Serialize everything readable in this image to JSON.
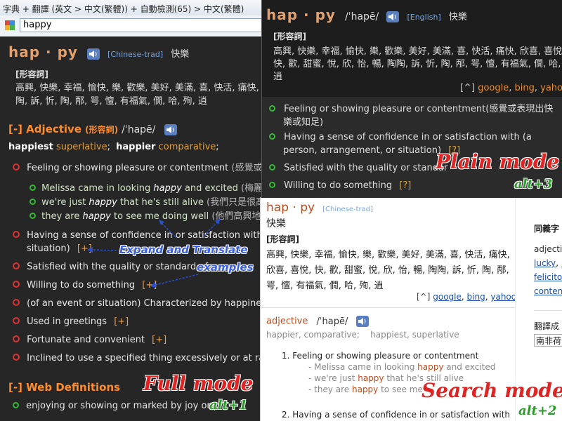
{
  "window": {
    "title": "字典 + 翻譯 (英文 > 中文(繁體)) + 自動檢測(65) > 中文(繁體)"
  },
  "search": {
    "value": "happy"
  },
  "full": {
    "headword": "hap · py",
    "lang_tag": "[Chinese-trad]",
    "zh_word": "快樂",
    "pos_zh": "[形容詞]",
    "zh_line1": "高興, 快樂, 幸福, 愉快, 樂, 歡樂, 美好, 美滿, 喜, 快活, 痛快, 欣",
    "zh_line2": "陶, 訴, 忻, 陶, 邴, 咢, 憻, 有福氣, 僩, 哈, 殉, 逍",
    "adj_head": "[-] Adjective",
    "adj_zh": "(形容詞)",
    "adj_pron": "/ˈhapē/",
    "forms": [
      {
        "w": "happiest",
        "t": "superlative"
      },
      {
        "w": "happier",
        "t": "comparative"
      }
    ],
    "senses": [
      {
        "text": "Feeling or showing pleasure or contentment",
        "zh": "(感覺或表",
        "plus": ""
      },
      {
        "text": "Having a sense of confidence in or satisfaction with (a",
        "zh": "",
        "plus": ""
      },
      {
        "text": "situation)",
        "zh": "",
        "plus": "[+]"
      },
      {
        "text": "Satisfied with the quality or standard of",
        "zh": "",
        "plus": ""
      },
      {
        "text": "Willing to do something",
        "zh": "",
        "plus": "[+]"
      },
      {
        "text": "(of an event or situation) Characterized by happiness",
        "zh": "",
        "plus": ""
      },
      {
        "text": "Used in greetings",
        "zh": "",
        "plus": "[+]"
      },
      {
        "text": "Fortunate and convenient",
        "zh": "",
        "plus": "[+]"
      },
      {
        "text": "Inclined to use a specified thing excessively or at rando",
        "zh": "",
        "plus": ""
      }
    ],
    "examples": [
      {
        "a": "Melissa came in looking ",
        "b": "happy",
        "c": " and excited",
        "zh": "(梅麗莎"
      },
      {
        "a": "we're just ",
        "b": "happy",
        "c": " that he's still alive",
        "zh": "(我們只是很高興"
      },
      {
        "a": "they are ",
        "b": "happy",
        "c": " to see me doing well",
        "zh": "(他們高興地看到"
      }
    ],
    "web_head": "[-] Web Definitions",
    "web_line1": "enjoying or showing or marked by joy or pl",
    "web_line1b": "a h"
  },
  "plain": {
    "headword": "hap · py",
    "pron": "/ˈhapē/",
    "lang_tag": "[English]",
    "zh_word": "快樂",
    "pos_zh": "[形容詞]",
    "zh_line1": "高興, 快樂, 幸福, 愉快, 樂, 歡樂, 美好, 美滿, 喜, 快活, 痛快, 欣喜, 喜悅,",
    "zh_line2": "快, 歡, 甜蜜, 悅, 欣, 怡, 暢, 陶陶, 訴, 忻, 陶, 邴, 咢, 憻, 有福氣, 僩, 哈, 殉,",
    "zh_line3": "逍",
    "links_prefix": "[^]",
    "links": [
      "google",
      "bing",
      "yahoo"
    ],
    "senses": [
      {
        "text": "Feeling or showing pleasure or contentment",
        "zh": "(感覺或表現出快",
        "zh2": "樂或知足)"
      },
      {
        "text": "Having a sense of confidence in or satisfaction with (a",
        "zh": "",
        "zh2": "person, arrangement, or situation)"
      },
      {
        "text": "Satisfied with the quality or standar",
        "zh": "",
        "zh2": ""
      },
      {
        "text": "Willing to do something",
        "zh": "",
        "zh2": ""
      }
    ],
    "q": "[?]"
  },
  "searchmode": {
    "headword": "hap · py",
    "lang_tag": "[Chinese-trad]",
    "zh_word": "快樂",
    "pos_zh": "[形容詞]",
    "zh_line1": "高興, 快樂, 幸福, 愉快, 樂, 歡樂, 美好, 美滿, 喜, 快活, 痛快,",
    "zh_line2": "欣喜, 喜悅, 快, 歡, 甜蜜, 悅, 欣, 怡, 暢, 陶陶, 訴, 忻, 陶, 邴,",
    "zh_line3": "咢, 憻, 有福氣, 僩, 哈, 殉, 逍",
    "links_prefix": "[^]",
    "links": [
      "google",
      "bing",
      "yahoo"
    ],
    "pos": "adjective",
    "pron": "/ˈhapē/",
    "forms": "happier, comparative;    happiest, superlative",
    "sense1": "1.  Feeling or showing pleasure or contentment",
    "ex1a": "- Melissa came in looking ",
    "ex1b": "happy",
    "ex1c": " and excited",
    "ex2a": "- we're just ",
    "ex2b": "happy",
    "ex2c": " that he's still alive",
    "ex3a": "- they are ",
    "ex3b": "happy",
    "ex3c": " to see me",
    "sense2": "2.  Having a sense of confidence in or satisfaction with",
    "side_head": "同義字",
    "side_words": [
      "adjectiv",
      "lucky",
      "r",
      "felicitou",
      "content"
    ],
    "side_trans": "翻譯成",
    "side_select": "南非荷"
  },
  "labels": {
    "plain": "Plain mode",
    "plain_key": "alt+3",
    "full": "Full mode",
    "full_key": "alt+1",
    "search": "Search mode",
    "search_key": "alt+2",
    "expand": "Expand and Translate",
    "examples": "examples"
  }
}
